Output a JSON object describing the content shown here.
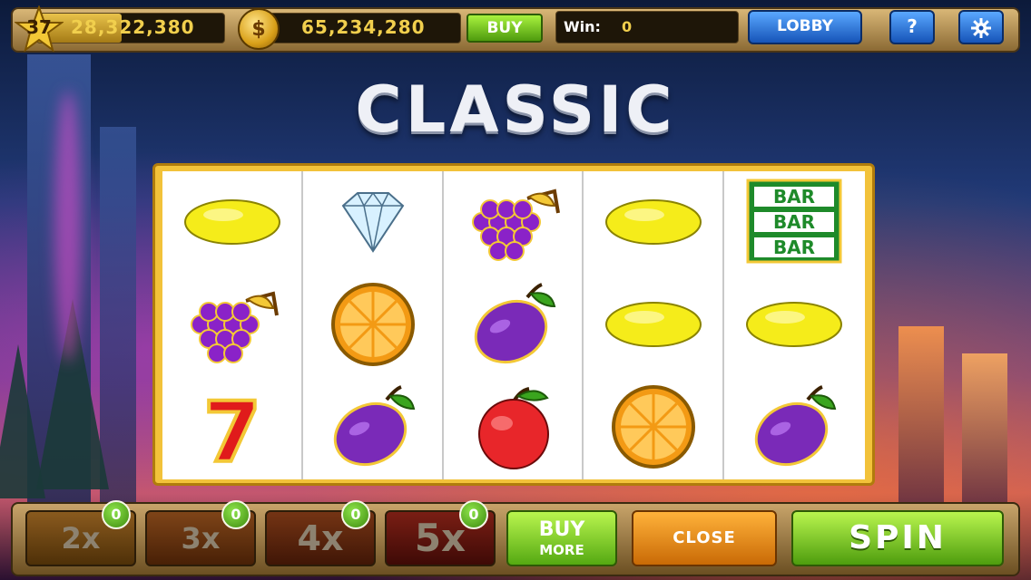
{
  "top_bar": {
    "level": "37",
    "level_progress": 0.45,
    "xp_value": "28,322,380",
    "coin_symbol": "$",
    "coins": "65,234,280",
    "buy_label": "BUY",
    "win_label": "Win:",
    "win_value": "0",
    "lobby_label": "LOBBY",
    "help_label": "?",
    "settings_icon": "gear-icon"
  },
  "title": "CLASSIC",
  "reels": [
    [
      "lemon",
      "grapes",
      "seven"
    ],
    [
      "diamond",
      "orange",
      "plum"
    ],
    [
      "grapes",
      "plum",
      "apple"
    ],
    [
      "lemon",
      "lemon",
      "orange"
    ],
    [
      "triple-bar",
      "lemon",
      "plum"
    ]
  ],
  "bar_text": "BAR",
  "seven_text": "7",
  "bottom_bar": {
    "multipliers": [
      {
        "label": "2x",
        "count": "0"
      },
      {
        "label": "3x",
        "count": "0"
      },
      {
        "label": "4x",
        "count": "0"
      },
      {
        "label": "5x",
        "count": "0"
      }
    ],
    "buy_more_line1": "BUY",
    "buy_more_line2": "MORE",
    "close_label": "CLOSE",
    "spin_label": "SPIN"
  },
  "colors": {
    "accent_green": "#6cc21c",
    "accent_blue": "#1f6fd8",
    "frame_gold": "#f2c23a",
    "value_gold": "#f1cf4d"
  }
}
